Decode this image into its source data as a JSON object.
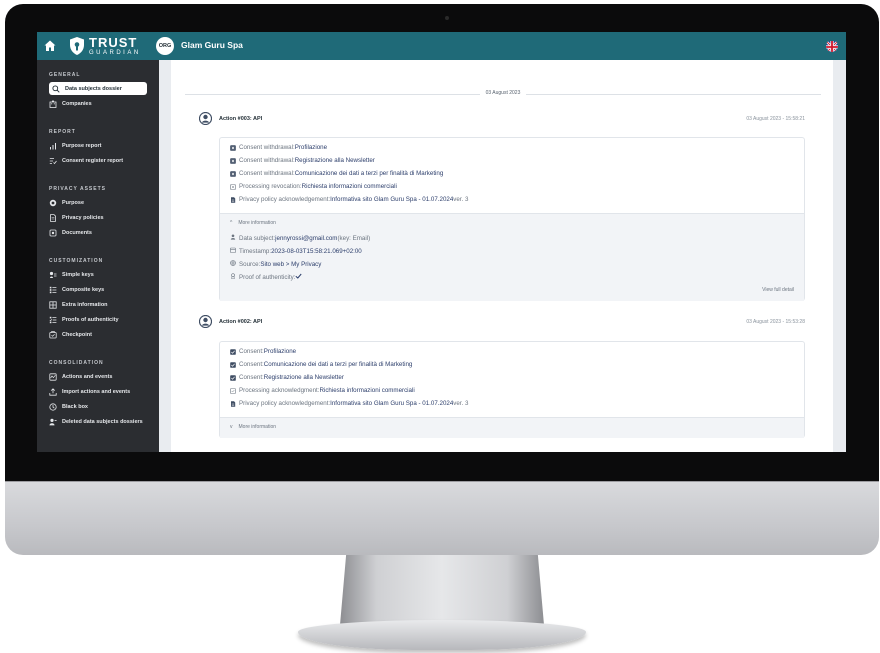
{
  "topbar": {
    "logo_title": "TRUST",
    "logo_subtitle": "GUARDIAN",
    "org_badge": "ORG",
    "org_name": "Glam Guru Spa"
  },
  "sidebar": {
    "sections": [
      {
        "title": "GENERAL",
        "items": [
          {
            "label": "Data subjects dossier",
            "icon": "search-icon",
            "active": true
          },
          {
            "label": "Companies",
            "icon": "building-icon"
          }
        ]
      },
      {
        "title": "REPORT",
        "items": [
          {
            "label": "Purpose report",
            "icon": "bar-chart-icon"
          },
          {
            "label": "Consent register report",
            "icon": "checklist-icon"
          }
        ]
      },
      {
        "title": "PRIVACY ASSETS",
        "items": [
          {
            "label": "Purpose",
            "icon": "target-icon"
          },
          {
            "label": "Privacy policies",
            "icon": "document-icon"
          },
          {
            "label": "Documents",
            "icon": "folder-icon"
          }
        ]
      },
      {
        "title": "CUSTOMIZATION",
        "items": [
          {
            "label": "Simple keys",
            "icon": "key-icon"
          },
          {
            "label": "Composite keys",
            "icon": "list-icon"
          },
          {
            "label": "Extra information",
            "icon": "grid-icon"
          },
          {
            "label": "Proofs of authenticity",
            "icon": "list-check-icon"
          },
          {
            "label": "Checkpoint",
            "icon": "checkpoint-icon"
          }
        ]
      },
      {
        "title": "CONSOLIDATION",
        "items": [
          {
            "label": "Actions and events",
            "icon": "activity-icon"
          },
          {
            "label": "Import actions and events",
            "icon": "upload-icon"
          },
          {
            "label": "Black box",
            "icon": "box-icon"
          },
          {
            "label": "Deleted data subjects dossiers",
            "icon": "user-remove-icon"
          }
        ]
      }
    ]
  },
  "main": {
    "date_separator": "03 August 2023",
    "actions": [
      {
        "title": "Action #003: API",
        "time": "03 August 2023 - 15:58:21",
        "events": [
          {
            "label": "Consent withdrawal: ",
            "value": "Profilazione",
            "icon": "square-x-icon"
          },
          {
            "label": "Consent withdrawal: ",
            "value": "Registrazione alla Newsletter",
            "icon": "square-x-icon"
          },
          {
            "label": "Consent withdrawal: ",
            "value": "Comunicazione dei dati a terzi per finalità di Marketing",
            "icon": "square-x-icon"
          },
          {
            "label": "Processing revocation: ",
            "value": "Richiesta informazioni commerciali",
            "icon": "square-outline-icon"
          },
          {
            "label": "Privacy policy acknowledgement: ",
            "value": "Informativa sito Glam Guru Spa - 01.07.2024",
            "suffix": " ver. 3",
            "icon": "file-icon"
          }
        ],
        "more_label": "More information",
        "details": {
          "data_subject_label": "Data subject: ",
          "data_subject_value": "jennyrossi@gmail.com",
          "data_subject_key": " (key: Email)",
          "timestamp_label": "Timestamp: ",
          "timestamp_value": "2023-08-03T15:58:21.069+02:00",
          "source_label": "Source: ",
          "source_value": "Sito web > My Privacy",
          "proof_label": "Proof of authenticity: ",
          "view_full": "View full detail"
        }
      },
      {
        "title": "Action #002: API",
        "time": "03 August 2023 - 15:53:28",
        "events": [
          {
            "label": "Consent: ",
            "value": "Profilazione",
            "icon": "square-check-icon"
          },
          {
            "label": "Consent: ",
            "value": "Comunicazione dei dati a terzi per finalità di Marketing",
            "icon": "square-check-icon"
          },
          {
            "label": "Consent: ",
            "value": "Registrazione alla Newsletter",
            "icon": "square-check-icon"
          },
          {
            "label": "Processing acknowledgment: ",
            "value": "Richiesta informazioni commerciali",
            "icon": "square-outline-icon"
          },
          {
            "label": "Privacy policy acknowledgement: ",
            "value": "Informativa sito Glam Guru Spa - 01.07.2024",
            "suffix": " ver. 3",
            "icon": "file-icon"
          }
        ],
        "more_label": "More information"
      }
    ]
  },
  "colors": {
    "topbar": "#1f6a78",
    "sidebar": "#2b2d31",
    "link_value": "#2c3e6b"
  }
}
